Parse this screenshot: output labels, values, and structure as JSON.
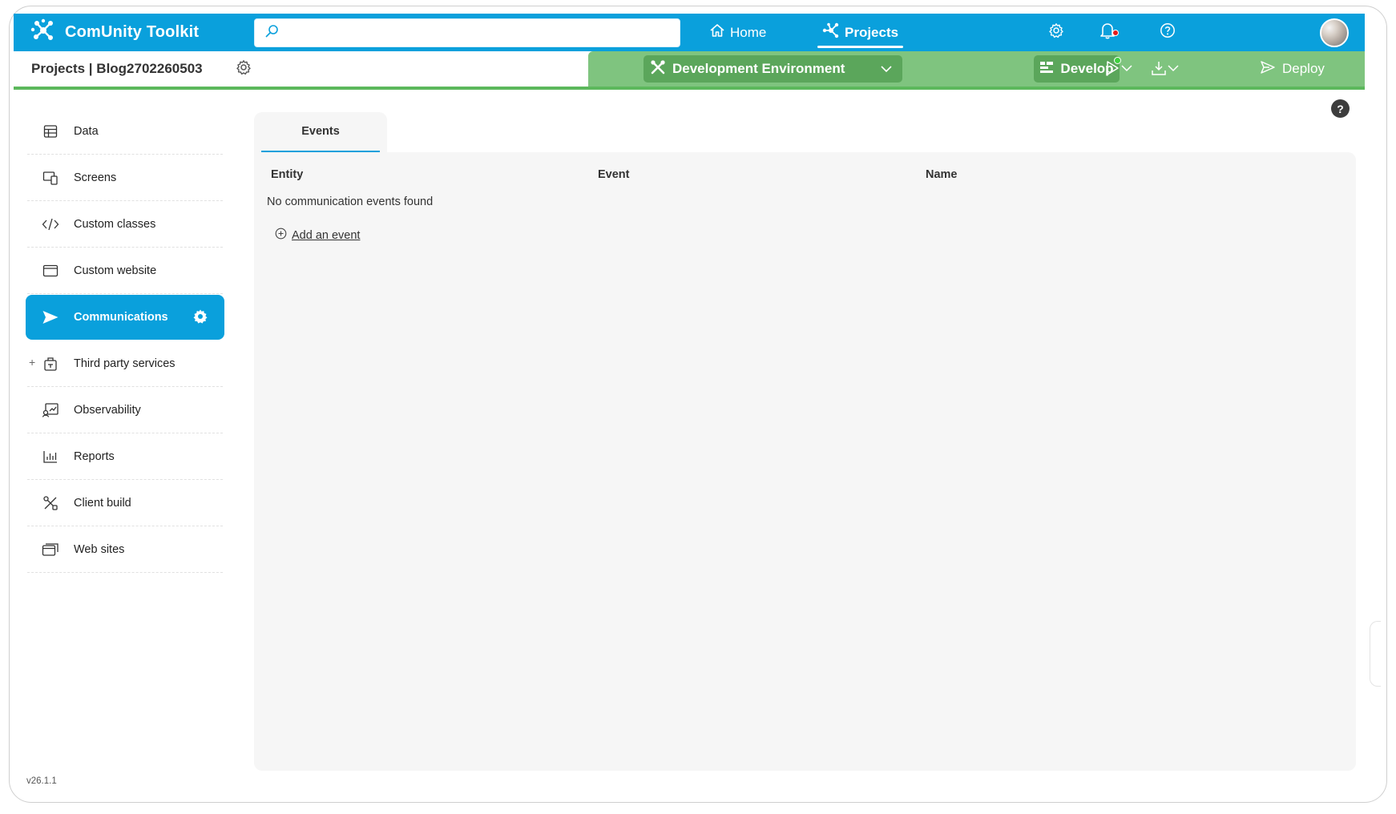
{
  "app": {
    "brand_name": "ComUnity Toolkit"
  },
  "search": {
    "placeholder": ""
  },
  "nav": {
    "home": "Home",
    "projects": "Projects"
  },
  "subbar": {
    "project_title": "Projects | Blog2702260503",
    "environment": "Development Environment",
    "develop": "Develop",
    "deploy": "Deploy"
  },
  "sidebar": {
    "items": [
      {
        "label": "Data",
        "icon": "table-icon"
      },
      {
        "label": "Screens",
        "icon": "screens-icon"
      },
      {
        "label": "Custom classes",
        "icon": "code-icon"
      },
      {
        "label": "Custom website",
        "icon": "browser-window-icon"
      },
      {
        "label": "Communications",
        "icon": "send-icon",
        "active": true
      },
      {
        "label": "Third party services",
        "icon": "plugin-icon"
      },
      {
        "label": "Observability",
        "icon": "observability-icon"
      },
      {
        "label": "Reports",
        "icon": "bar-chart-icon"
      },
      {
        "label": "Client build",
        "icon": "tools-icon"
      },
      {
        "label": "Web sites",
        "icon": "websites-icon"
      }
    ]
  },
  "main": {
    "tab": "Events",
    "columns": [
      "Entity",
      "Event",
      "Name"
    ],
    "empty_message": "No communication events found",
    "add_event": "Add an event"
  },
  "footer": {
    "version": "v26.1.1"
  },
  "help": {
    "label": "?"
  },
  "colors": {
    "primary": "#0aa0dc",
    "env_green": "#7fc47f",
    "env_dark": "#5ba65b",
    "accent_line": "#5cb85c"
  }
}
